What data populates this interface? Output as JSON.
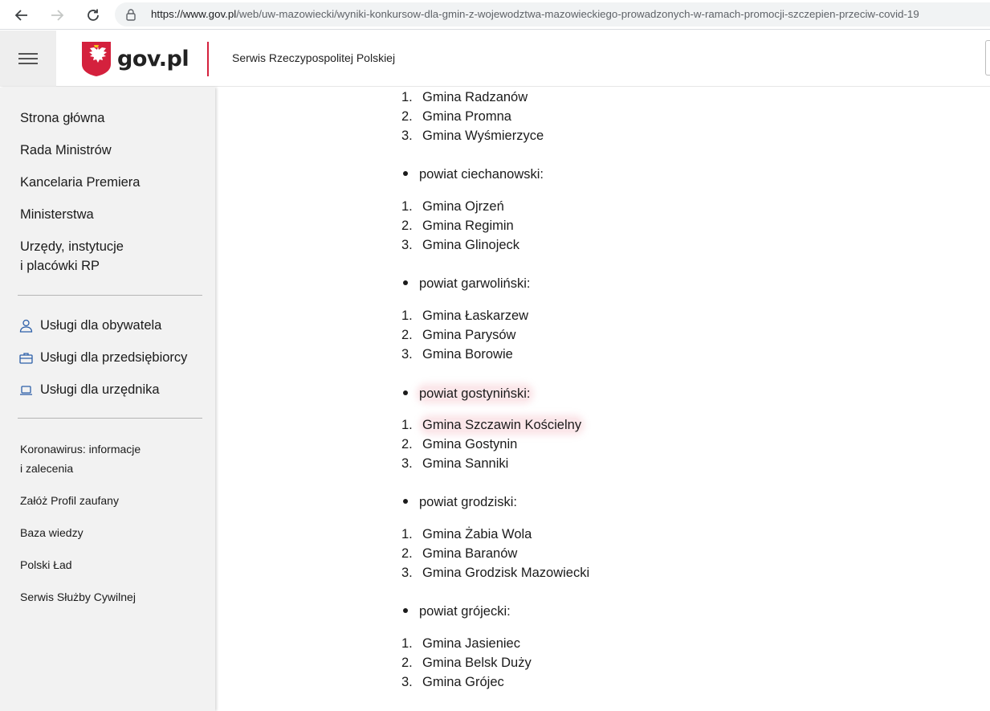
{
  "browser": {
    "url_host": "https://www.gov.pl",
    "url_path": "/web/uw-mazowiecki/wyniki-konkursow-dla-gmin-z-wojewodztwa-mazowieckiego-prowadzonych-w-ramach-promocji-szczepien-przeciw-covid-19"
  },
  "header": {
    "logo_text": "gov.pl",
    "service_name": "Serwis Rzeczypospolitej Polskiej",
    "brand_red": "#d4213d"
  },
  "sidebar": {
    "main_links": [
      "Strona główna",
      "Rada Ministrów",
      "Kancelaria Premiera",
      "Ministerstwa",
      "Urzędy, instytucje",
      "i placówki RP"
    ],
    "services": [
      {
        "label": "Usługi dla obywatela",
        "icon": "person-icon"
      },
      {
        "label": "Usługi dla przedsiębiorcy",
        "icon": "briefcase-icon"
      },
      {
        "label": "Usługi dla urzędnika",
        "icon": "laptop-icon"
      }
    ],
    "small_links": [
      "Koronawirus: informacje",
      "i zalecenia",
      "Załóż Profil zaufany",
      "Baza wiedzy",
      "Polski Ład",
      "Serwis Służby Cywilnej"
    ]
  },
  "content": {
    "groups": [
      {
        "items": [
          "Gmina Radzanów",
          "Gmina Promna",
          "Gmina Wyśmierzyce"
        ]
      },
      {
        "county": "powiat ciechanowski:",
        "items": [
          "Gmina Ojrzeń",
          "Gmina Regimin",
          "Gmina Glinojeck"
        ]
      },
      {
        "county": "powiat garwoliński:",
        "items": [
          "Gmina Łaskarzew",
          "Gmina Parysów",
          "Gmina Borowie"
        ]
      },
      {
        "county": "powiat gostyniński:",
        "items": [
          "Gmina Szczawin Kościelny",
          "Gmina Gostynin",
          "Gmina Sanniki"
        ]
      },
      {
        "county": "powiat grodziski:",
        "items": [
          "Gmina Żabia Wola",
          "Gmina Baranów",
          "Gmina Grodzisk Mazowiecki"
        ]
      },
      {
        "county": "powiat grójecki:",
        "items": [
          "Gmina Jasieniec",
          "Gmina Belsk Duży",
          "Gmina Grójec"
        ]
      }
    ],
    "numbers": [
      "1.",
      "2.",
      "3."
    ]
  }
}
